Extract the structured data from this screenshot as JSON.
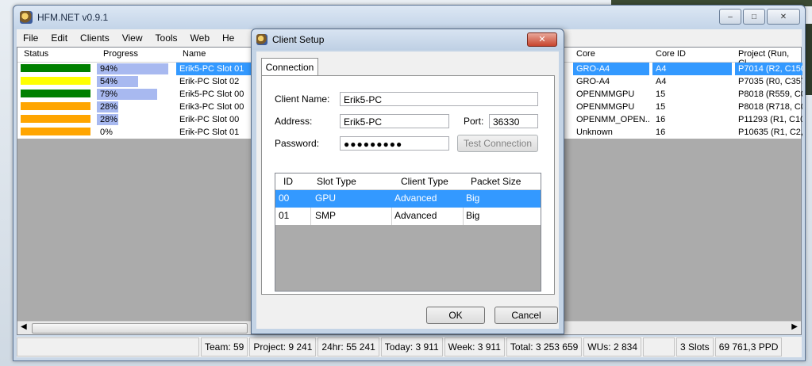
{
  "window": {
    "title": "HFM.NET v0.9.1",
    "caption_min": "–",
    "caption_max": "□",
    "caption_close": "✕"
  },
  "menu": [
    "File",
    "Edit",
    "Clients",
    "View",
    "Tools",
    "Web",
    "He"
  ],
  "grid": {
    "headers": {
      "status": "Status",
      "progress": "Progress",
      "name": "Name",
      "core": "Core",
      "core_id": "Core ID",
      "project": "Project (Run, Cl..."
    },
    "rows": [
      {
        "status_color": "#008000",
        "progress_text": "94%",
        "progress": 0.94,
        "name": "Erik5-PC Slot 01",
        "core": "GRO-A4",
        "core_id": "A4",
        "project": "P7014 (R2, C150"
      },
      {
        "status_color": "#ffff00",
        "progress_text": "54%",
        "progress": 0.54,
        "name": "Erik-PC Slot 02",
        "core": "GRO-A4",
        "core_id": "A4",
        "project": "P7035 (R0, C357"
      },
      {
        "status_color": "#008000",
        "progress_text": "79%",
        "progress": 0.79,
        "name": "Erik5-PC Slot 00",
        "core": "OPENMMGPU",
        "core_id": "15",
        "project": "P8018 (R559, C0"
      },
      {
        "status_color": "#ffa500",
        "progress_text": "28%",
        "progress": 0.28,
        "name": "Erik3-PC Slot 00",
        "core": "OPENMMGPU",
        "core_id": "15",
        "project": "P8018 (R718, C0"
      },
      {
        "status_color": "#ffa500",
        "progress_text": "28%",
        "progress": 0.28,
        "name": "Erik-PC Slot 00",
        "core": "OPENMM_OPEN...",
        "core_id": "16",
        "project": "P11293 (R1, C10"
      },
      {
        "status_color": "#ffa500",
        "progress_text": "0%",
        "progress": 0.0,
        "name": "Erik-PC Slot 01",
        "core": "Unknown",
        "core_id": "16",
        "project": "P10635 (R1, C2,"
      }
    ]
  },
  "statusbar": {
    "team": "Team: 59",
    "project": "Project: 9 241",
    "h24": "24hr: 55 241",
    "today": "Today: 3 911",
    "week": "Week: 3 911",
    "total": "Total: 3 253 659",
    "wus": "WUs: 2 834",
    "slots": "3 Slots",
    "ppd": "69 761,3 PPD"
  },
  "dialog": {
    "title": "Client Setup",
    "close": "✕",
    "tab": "Connection",
    "client_name_label": "Client Name:",
    "client_name_value": "Erik5-PC",
    "address_label": "Address:",
    "address_value": "Erik5-PC",
    "port_label": "Port:",
    "port_value": "36330",
    "password_label": "Password:",
    "password_value": "●●●●●●●●●",
    "test_button": "Test Connection",
    "slot_headers": {
      "id": "ID",
      "slot_type": "Slot Type",
      "client_type": "Client Type",
      "packet_size": "Packet Size"
    },
    "slots": [
      {
        "id": "00",
        "slot_type": "GPU",
        "client_type": "Advanced",
        "packet_size": "Big"
      },
      {
        "id": "01",
        "slot_type": "SMP",
        "client_type": "Advanced",
        "packet_size": "Big"
      }
    ],
    "ok": "OK",
    "cancel": "Cancel"
  }
}
